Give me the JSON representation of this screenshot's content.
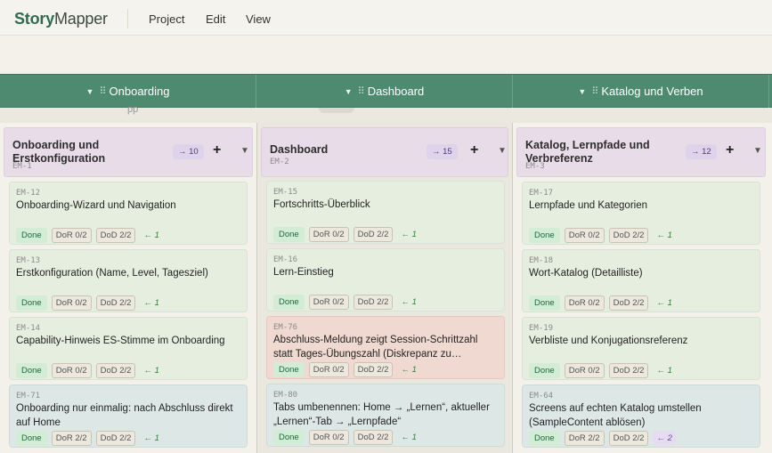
{
  "app": {
    "logo_bold": "Story",
    "logo_light": "Mapper"
  },
  "menu": [
    "Project",
    "Edit",
    "View"
  ],
  "strip_fragment": "pp",
  "epics": [
    "Onboarding",
    "Dashboard",
    "Katalog und Verben"
  ],
  "columns": [
    {
      "title": "Onboarding und Erstkonfiguration",
      "id": "EM-1",
      "count": "→ 10",
      "cards": [
        {
          "id": "EM-12",
          "title": "Onboarding-Wizard und Navigation",
          "status": "Done",
          "dor": "DoR 0/2",
          "dod": "DoD 2/2",
          "link": "← 1",
          "tone": "green"
        },
        {
          "id": "EM-13",
          "title": "Erstkonfiguration (Name, Level, Tagesziel)",
          "status": "Done",
          "dor": "DoR 0/2",
          "dod": "DoD 2/2",
          "link": "← 1",
          "tone": "green"
        },
        {
          "id": "EM-14",
          "title": "Capability-Hinweis ES-Stimme im Onboarding",
          "status": "Done",
          "dor": "DoR 0/2",
          "dod": "DoD 2/2",
          "link": "← 1",
          "tone": "green"
        },
        {
          "id": "EM-71",
          "title": "Onboarding nur einmalig: nach Abschluss direkt auf Home",
          "status": "Done",
          "dor": "DoR 2/2",
          "dod": "DoD 2/2",
          "link": "← 1",
          "tone": "blue"
        }
      ]
    },
    {
      "title": "Dashboard",
      "id": "EM-2",
      "count": "→ 15",
      "cards": [
        {
          "id": "EM-15",
          "title": "Fortschritts-Überblick",
          "status": "Done",
          "dor": "DoR 0/2",
          "dod": "DoD 2/2",
          "link": "← 1",
          "tone": "green"
        },
        {
          "id": "EM-16",
          "title": "Lern-Einstieg",
          "status": "Done",
          "dor": "DoR 0/2",
          "dod": "DoD 2/2",
          "link": "← 1",
          "tone": "green"
        },
        {
          "id": "EM-76",
          "title": "Abschluss-Meldung zeigt Session-Schrittzahl statt Tages-Übungszahl (Diskrepanz zu…",
          "status": "Done",
          "dor": "DoR 0/2",
          "dod": "DoD 2/2",
          "link": "← 1",
          "tone": "red"
        },
        {
          "id": "EM-80",
          "title": "Tabs umbenennen: Home → „Lernen“, aktueller „Lernen“-Tab → „Lernpfade“",
          "status": "Done",
          "dor": "DoR 0/2",
          "dod": "DoD 2/2",
          "link": "← 1",
          "tone": "blue"
        }
      ]
    },
    {
      "title": "Katalog, Lernpfade und Verbreferenz",
      "id": "EM-3",
      "count": "→ 12",
      "cards": [
        {
          "id": "EM-17",
          "title": "Lernpfade und Kategorien",
          "status": "Done",
          "dor": "DoR 0/2",
          "dod": "DoD 2/2",
          "link": "← 1",
          "tone": "green"
        },
        {
          "id": "EM-18",
          "title": "Wort-Katalog (Detailliste)",
          "status": "Done",
          "dor": "DoR 0/2",
          "dod": "DoD 2/2",
          "link": "← 1",
          "tone": "green"
        },
        {
          "id": "EM-19",
          "title": "Verbliste und Konjugationsreferenz",
          "status": "Done",
          "dor": "DoR 0/2",
          "dod": "DoD 2/2",
          "link": "← 1",
          "tone": "green"
        },
        {
          "id": "EM-64",
          "title": "Screens auf echten Katalog umstellen (SampleContent ablösen)",
          "status": "Done",
          "dor": "DoR 2/2",
          "dod": "DoD 2/2",
          "link": "← 2",
          "tone": "blue"
        }
      ]
    }
  ],
  "colors": {
    "brand": "#2f6a53",
    "epic_bar": "#4e8a70",
    "feature_head": "#e9dce9",
    "done": "#d3ecd6"
  },
  "icons": {
    "add": "plus-icon",
    "collapse": "caret-down-icon",
    "drag": "drag-handle-icon"
  }
}
